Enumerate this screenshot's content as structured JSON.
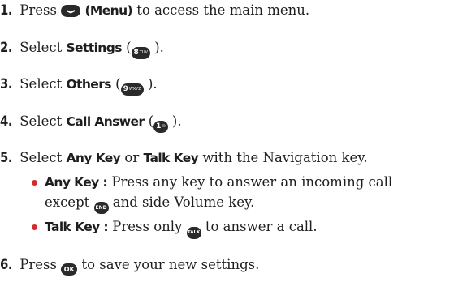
{
  "steps": [
    {
      "num": "1.",
      "before": "Press",
      "key": "",
      "paren_bold": "(Menu)",
      "after": "to access the main menu."
    },
    {
      "num": "2.",
      "before": "Select",
      "bold": "Settings",
      "open": "(",
      "key": "8",
      "key_sub": "TUV",
      "close": ")."
    },
    {
      "num": "3.",
      "before": "Select",
      "bold": "Others",
      "open": "(",
      "key": "9",
      "key_sub": "WXYZ",
      "close": ")."
    },
    {
      "num": "4.",
      "before": "Select",
      "bold": "Call Answer",
      "open": "(",
      "key": "1",
      "key_sub": "✉",
      "close": ")."
    },
    {
      "num": "5.",
      "before": "Select",
      "bold1": "Any Key",
      "mid": "or",
      "bold2": "Talk Key",
      "after": "with the Navigation key."
    },
    {
      "num": "6.",
      "before": "Press",
      "key": "OK",
      "after": "to save your new settings."
    }
  ],
  "bullets": [
    {
      "bold": "Any Key :",
      "text1": "Press any key to answer an incoming call",
      "text2a": "except",
      "key": "END",
      "text2b": "and side Volume key."
    },
    {
      "bold": "Talk Key :",
      "text": "Press only",
      "key": "TALK",
      "after": "to answer a call."
    }
  ],
  "colors": {
    "text": "#1e1e1e",
    "bullet": "#d42c2c",
    "key_bg": "#2a2a2a"
  },
  "icons": [
    "menu-softkey-icon",
    "key-8-icon",
    "key-9-icon",
    "key-1-icon",
    "end-key-icon",
    "talk-key-icon",
    "ok-key-icon"
  ]
}
